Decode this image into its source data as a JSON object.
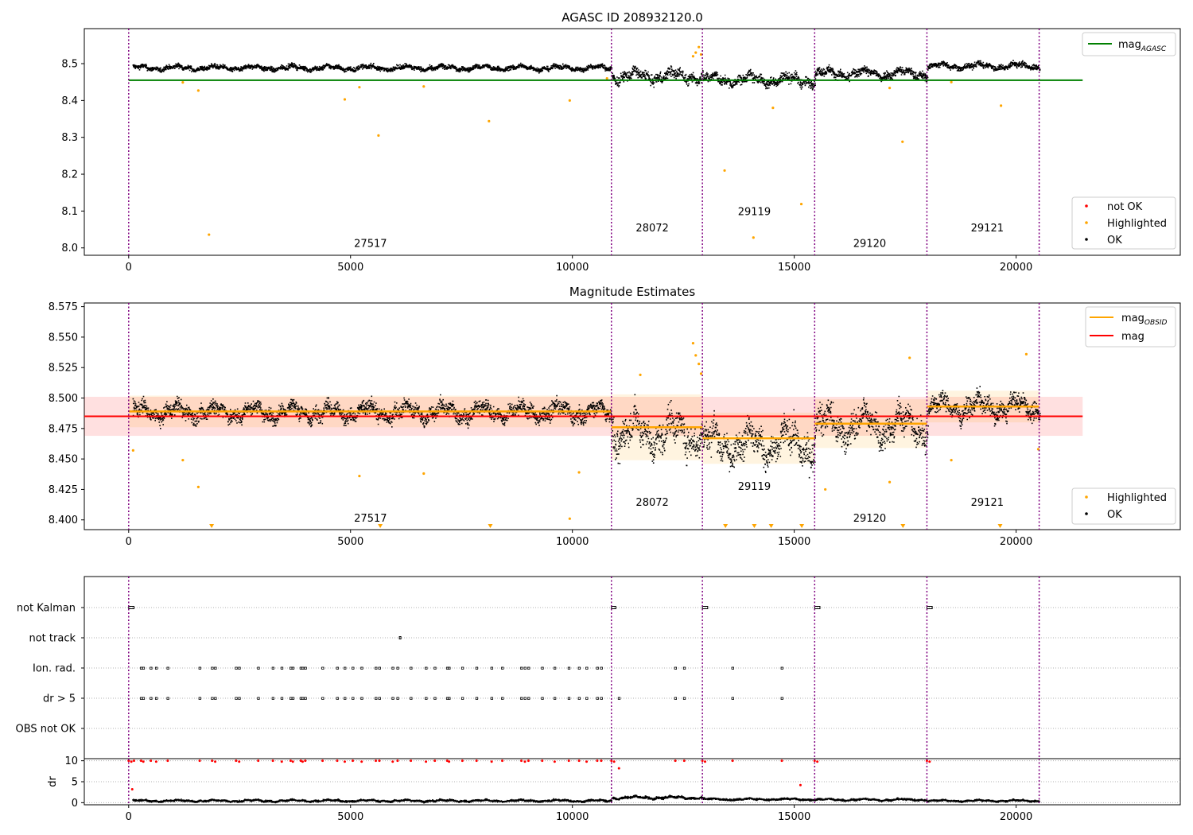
{
  "chart_data": [
    {
      "type": "scatter",
      "title": "AGASC ID 208932120.0",
      "xlim": [
        -1000,
        23700
      ],
      "ylim": [
        7.98,
        8.595
      ],
      "x_ticks": [
        0,
        5000,
        10000,
        15000,
        20000
      ],
      "y_ticks": [
        8.0,
        8.1,
        8.2,
        8.3,
        8.4,
        8.5
      ],
      "y_tick_labels": [
        "8.0",
        "8.1",
        "8.2",
        "8.3",
        "8.4",
        "8.5"
      ],
      "obsid_boundaries": [
        0,
        10880,
        12930,
        15460,
        17990,
        20520
      ],
      "obsid_labels": [
        {
          "text": "27517",
          "x": 5450,
          "y": 8.0
        },
        {
          "text": "28072",
          "x": 11800,
          "y": 8.043
        },
        {
          "text": "29119",
          "x": 14100,
          "y": 8.087
        },
        {
          "text": "29120",
          "x": 16700,
          "y": 8.0
        },
        {
          "text": "29121",
          "x": 19350,
          "y": 8.043
        }
      ],
      "lines": [
        {
          "name": "mag_AGASC",
          "x": [
            0,
            21500
          ],
          "y": [
            8.455,
            8.455
          ],
          "color": "#008000"
        }
      ],
      "ok_segments": [
        {
          "x0": 80,
          "x1": 10880,
          "center": 8.49,
          "spread": 0.013
        },
        {
          "x0": 10880,
          "x1": 12930,
          "center": 8.468,
          "spread": 0.03
        },
        {
          "x0": 12930,
          "x1": 15460,
          "center": 8.458,
          "spread": 0.028
        },
        {
          "x0": 15460,
          "x1": 17990,
          "center": 8.475,
          "spread": 0.024
        },
        {
          "x0": 17990,
          "x1": 20520,
          "center": 8.495,
          "spread": 0.016
        }
      ],
      "highlighted": {
        "x": [
          1810,
          1570,
          4870,
          5630,
          8120,
          9940,
          10780,
          13430,
          14080,
          14520,
          15160,
          17440,
          19660,
          5200,
          6650,
          1220,
          12720,
          12780,
          12850,
          12900,
          17150,
          18540
        ],
        "y": [
          8.036,
          8.427,
          8.403,
          8.305,
          8.344,
          8.4,
          8.46,
          8.21,
          8.028,
          8.38,
          8.119,
          8.288,
          8.386,
          8.436,
          8.438,
          8.449,
          8.52,
          8.53,
          8.545,
          8.525,
          8.434,
          8.45
        ],
        "color": "#ffa500"
      },
      "legends": [
        {
          "entries": [
            {
              "label": "mag",
              "subscript": "AGASC",
              "kind": "line",
              "color": "#008000"
            }
          ]
        },
        {
          "entries": [
            {
              "label": "not OK",
              "kind": "marker",
              "color": "#ff0000"
            },
            {
              "label": "Highlighted",
              "kind": "marker",
              "color": "#ffa500"
            },
            {
              "label": "OK",
              "kind": "marker",
              "color": "#000000"
            }
          ]
        }
      ]
    },
    {
      "type": "scatter",
      "title": "Magnitude Estimates",
      "xlim": [
        -1000,
        23700
      ],
      "ylim": [
        8.392,
        8.578
      ],
      "x_ticks": [
        0,
        5000,
        10000,
        15000,
        20000
      ],
      "y_ticks": [
        8.4,
        8.425,
        8.45,
        8.475,
        8.5,
        8.525,
        8.55,
        8.575
      ],
      "y_tick_labels": [
        "8.400",
        "8.425",
        "8.450",
        "8.475",
        "8.500",
        "8.525",
        "8.550",
        "8.575"
      ],
      "obsid_boundaries": [
        0,
        10880,
        12930,
        15460,
        17990,
        20520
      ],
      "obsid_labels": [
        {
          "text": "27517",
          "x": 5450,
          "y": 8.398
        },
        {
          "text": "28072",
          "x": 11800,
          "y": 8.411
        },
        {
          "text": "29119",
          "x": 14100,
          "y": 8.424
        },
        {
          "text": "29120",
          "x": 16700,
          "y": 8.398
        },
        {
          "text": "29121",
          "x": 19350,
          "y": 8.411
        }
      ],
      "mag": {
        "value": 8.485,
        "band": [
          8.469,
          8.501
        ],
        "x": [
          -1000,
          21500
        ],
        "color": "#ff0000"
      },
      "mag_obsid": [
        {
          "x0": 0,
          "x1": 10880,
          "value": 8.489,
          "band": [
            8.476,
            8.502
          ]
        },
        {
          "x0": 10880,
          "x1": 12930,
          "value": 8.476,
          "band": [
            8.449,
            8.503
          ]
        },
        {
          "x0": 12930,
          "x1": 15460,
          "value": 8.467,
          "band": [
            8.446,
            8.488
          ]
        },
        {
          "x0": 15460,
          "x1": 17990,
          "value": 8.479,
          "band": [
            8.459,
            8.499
          ]
        },
        {
          "x0": 17990,
          "x1": 20520,
          "value": 8.493,
          "band": [
            8.48,
            8.506
          ]
        }
      ],
      "ok_segments": [
        {
          "x0": 80,
          "x1": 10880,
          "center": 8.489,
          "spread": 0.013
        },
        {
          "x0": 10880,
          "x1": 12930,
          "center": 8.472,
          "spread": 0.028
        },
        {
          "x0": 12930,
          "x1": 15460,
          "center": 8.463,
          "spread": 0.027
        },
        {
          "x0": 15460,
          "x1": 17990,
          "center": 8.478,
          "spread": 0.025
        },
        {
          "x0": 17990,
          "x1": 20520,
          "center": 8.493,
          "spread": 0.016
        }
      ],
      "highlighted": {
        "x": [
          100,
          1220,
          1570,
          5200,
          6650,
          9940,
          10150,
          12720,
          12780,
          12850,
          12900,
          15700,
          17150,
          18540,
          20230,
          20500,
          11530,
          17600
        ],
        "y": [
          8.457,
          8.449,
          8.427,
          8.436,
          8.438,
          8.401,
          8.439,
          8.545,
          8.535,
          8.528,
          8.52,
          8.425,
          8.431,
          8.449,
          8.536,
          8.458,
          8.519,
          8.533
        ],
        "color": "#ffa500"
      },
      "offscale_markers": {
        "x": [
          1870,
          5670,
          8150,
          13450,
          14100,
          14480,
          15170,
          17450,
          19640
        ],
        "color": "#ffa500"
      },
      "legends": [
        {
          "entries": [
            {
              "label": "mag",
              "subscript": "OBSID",
              "kind": "line",
              "color": "#ffa500"
            },
            {
              "label": "mag",
              "kind": "line",
              "color": "#ff0000"
            }
          ]
        },
        {
          "entries": [
            {
              "label": "Highlighted",
              "kind": "marker",
              "color": "#ffa500"
            },
            {
              "label": "OK",
              "kind": "marker",
              "color": "#000000"
            }
          ]
        }
      ]
    },
    {
      "type": "scatter",
      "xlim": [
        -1000,
        23700
      ],
      "categories": [
        "not Kalman",
        "not track",
        "Ion. rad.",
        "dr > 5",
        "OBS not OK"
      ],
      "obsid_boundaries": [
        0,
        10880,
        12930,
        15460,
        17990,
        20520
      ],
      "flags": {
        "not Kalman": [
          [
            0,
            120
          ],
          [
            10880,
            10980
          ],
          [
            12930,
            13050
          ],
          [
            15460,
            15580
          ],
          [
            17990,
            18110
          ]
        ],
        "not track": [
          [
            6100,
            6130
          ]
        ],
        "Ion. rad.": [
          280,
          330,
          500,
          620,
          880,
          1600,
          1880,
          1950,
          2420,
          2490,
          2920,
          3250,
          3450,
          3650,
          3700,
          3880,
          3920,
          3980,
          4370,
          4700,
          4870,
          5050,
          5250,
          5570,
          5650,
          5950,
          6060,
          6360,
          6700,
          6900,
          7180,
          7220,
          7520,
          7840,
          8180,
          8420,
          8850,
          8930,
          9010,
          9320,
          9600,
          9920,
          10150,
          10320,
          10560,
          10650,
          12320,
          12520,
          13610,
          14720
        ],
        "dr > 5": [
          280,
          330,
          500,
          620,
          880,
          1600,
          1880,
          1950,
          2420,
          2490,
          2920,
          3250,
          3450,
          3650,
          3700,
          3880,
          3920,
          3980,
          4370,
          4700,
          4870,
          5050,
          5250,
          5570,
          5650,
          5950,
          6060,
          6360,
          6700,
          6900,
          7180,
          7220,
          7520,
          7840,
          8180,
          8420,
          8850,
          8930,
          9010,
          9320,
          9600,
          9920,
          10150,
          10320,
          10560,
          10650,
          11050,
          12320,
          12520,
          13610,
          14720
        ],
        "OBS not OK": []
      }
    },
    {
      "type": "scatter",
      "xlim": [
        -1000,
        23700
      ],
      "ylim": [
        -0.5,
        10.5
      ],
      "ylabel": "dr",
      "x_ticks": [
        0,
        5000,
        10000,
        15000,
        20000
      ],
      "y_ticks": [
        0,
        5,
        10
      ],
      "y_tick_labels": [
        "0",
        "5",
        "10"
      ],
      "obsid_boundaries": [
        0,
        10880,
        12930,
        15460,
        17990,
        20520
      ],
      "ok_segments": [
        {
          "x0": 80,
          "x1": 10880,
          "center": 0.6,
          "spread": 0.45
        },
        {
          "x0": 10880,
          "x1": 12930,
          "center": 1.35,
          "spread": 0.6
        },
        {
          "x0": 12930,
          "x1": 15460,
          "center": 0.95,
          "spread": 0.45
        },
        {
          "x0": 15460,
          "x1": 17990,
          "center": 0.85,
          "spread": 0.45
        },
        {
          "x0": 17990,
          "x1": 20520,
          "center": 0.6,
          "spread": 0.4
        }
      ],
      "not_ok": {
        "x": [
          0,
          60,
          120,
          280,
          330,
          500,
          620,
          880,
          1600,
          1880,
          1950,
          2420,
          2490,
          2920,
          3250,
          3450,
          3650,
          3700,
          3880,
          3920,
          3980,
          4370,
          4700,
          4870,
          5050,
          5250,
          5570,
          5650,
          5950,
          6060,
          6360,
          6700,
          6900,
          7180,
          7220,
          7520,
          7840,
          8180,
          8420,
          8850,
          8930,
          9010,
          9320,
          9600,
          9920,
          10150,
          10320,
          10560,
          10650,
          10880,
          10940,
          12320,
          12520,
          12930,
          12990,
          13610,
          14720,
          15460,
          15520,
          17990,
          18050,
          11050,
          80,
          15140
        ],
        "y": [
          10,
          9.8,
          10,
          10,
          9.8,
          10,
          9.8,
          10,
          10,
          10,
          9.8,
          10,
          9.8,
          10,
          10,
          9.8,
          10,
          9.8,
          10,
          9.8,
          10,
          10,
          10,
          9.8,
          10,
          9.8,
          10,
          10,
          9.8,
          10,
          10,
          9.8,
          10,
          10,
          9.8,
          10,
          10,
          9.8,
          10,
          10,
          9.8,
          10,
          10,
          9.8,
          10,
          10,
          9.8,
          10,
          10,
          10,
          9.8,
          10,
          10,
          10,
          9.8,
          10,
          10,
          10,
          9.8,
          10,
          9.8,
          8.2,
          3.2,
          4.2
        ],
        "color": "#ff0000"
      }
    }
  ]
}
